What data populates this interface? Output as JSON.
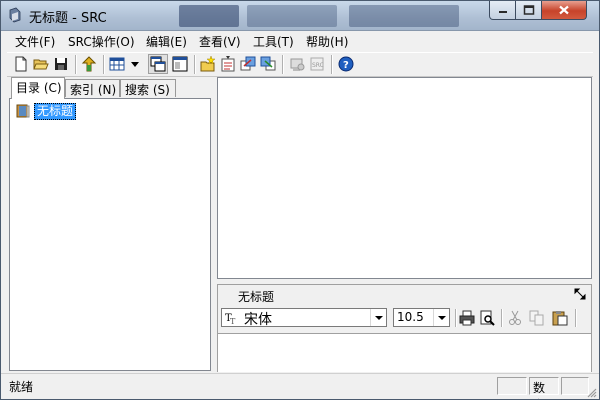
{
  "window": {
    "title": "无标题 - SRC"
  },
  "menu": {
    "items": [
      "文件(F)",
      "SRC操作(O)",
      "编辑(E)",
      "查看(V)",
      "工具(T)",
      "帮助(H)"
    ]
  },
  "toolbar": {
    "icons": [
      "new-file-icon",
      "open-folder-icon",
      "save-icon",
      "upload-arrow-icon",
      "grid-view-icon",
      "dropdown-arrow-icon",
      "window-cascade-icon",
      "window-pane-icon",
      "new-folder-star-icon",
      "compile-icon",
      "export-icon",
      "import-icon",
      "disabled-tool-icon",
      "disabled-src-icon",
      "help-icon"
    ]
  },
  "left_tabs": {
    "items": [
      "目录 (C)",
      "索引 (N)",
      "搜索 (S)"
    ],
    "active": 0
  },
  "tree": {
    "root_label": "无标题"
  },
  "editor": {
    "title": "无标题",
    "font_name": "宋体",
    "font_size": "10.5"
  },
  "status": {
    "text": "就绪",
    "mode": "数字"
  }
}
